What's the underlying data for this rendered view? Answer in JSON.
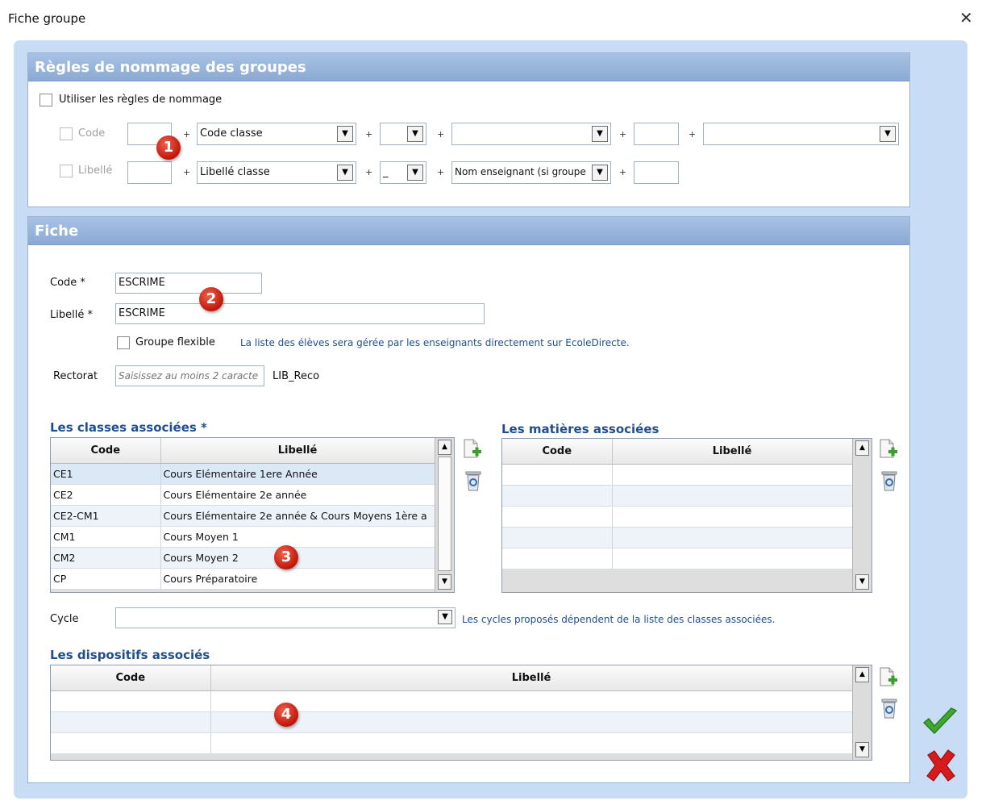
{
  "window": {
    "title": "Fiche groupe"
  },
  "naming": {
    "header": "Règles de nommage des groupes",
    "use_rules_label": "Utiliser les règles de nommage",
    "code_row": {
      "label": "Code",
      "dropdown1": "Code classe",
      "dropdown2": "",
      "dropdown3": "",
      "dropdown4": ""
    },
    "libelle_row": {
      "label": "Libellé",
      "dropdown1": "Libellé classe",
      "dropdown2": "_",
      "dropdown3": "Nom enseignant (si groupe"
    },
    "plus": "+"
  },
  "fiche": {
    "header": "Fiche",
    "code_label": "Code *",
    "code_value": "ESCRIME",
    "libelle_label": "Libellé *",
    "libelle_value": "ESCRIME",
    "flexible_label": "Groupe flexible",
    "flexible_hint": "La liste des élèves sera gérée par les enseignants directement sur EcoleDirecte.",
    "rectorat_label": "Rectorat",
    "rectorat_placeholder": "Saisissez au moins 2 caracte",
    "rectorat_value": "LIB_Reco",
    "classes": {
      "title": "Les classes associées *",
      "col_code": "Code",
      "col_libelle": "Libellé",
      "rows": [
        {
          "code": "CE1",
          "libelle": "Cours Elémentaire 1ere Année"
        },
        {
          "code": "CE2",
          "libelle": "Cours Elémentaire 2e année"
        },
        {
          "code": "CE2-CM1",
          "libelle": "Cours Elémentaire 2e année & Cours Moyens 1ère a"
        },
        {
          "code": "CM1",
          "libelle": "Cours Moyen 1"
        },
        {
          "code": "CM2",
          "libelle": "Cours Moyen 2"
        },
        {
          "code": "CP",
          "libelle": "Cours Préparatoire"
        }
      ]
    },
    "matieres": {
      "title": "Les matières associées",
      "col_code": "Code",
      "col_libelle": "Libellé"
    },
    "cycle_label": "Cycle",
    "cycle_value": "",
    "cycle_hint": "Les cycles proposés dépendent de la liste des classes associées.",
    "dispositifs": {
      "title": "Les dispositifs associés",
      "col_code": "Code",
      "col_libelle": "Libellé"
    }
  },
  "badges": {
    "b1": "1",
    "b2": "2",
    "b3": "3",
    "b4": "4"
  },
  "icons": {
    "close": "close-icon",
    "add": "add-document-icon",
    "delete": "trash-icon",
    "validate": "checkmark-icon",
    "cancel": "cancel-x-icon",
    "dropdown": "chevron-down-icon"
  },
  "colors": {
    "accent": "#1f4f8f",
    "header": "#8aa9d3",
    "badge": "#d42a17",
    "validate": "#3fa82e",
    "cancel": "#d51b1b"
  }
}
